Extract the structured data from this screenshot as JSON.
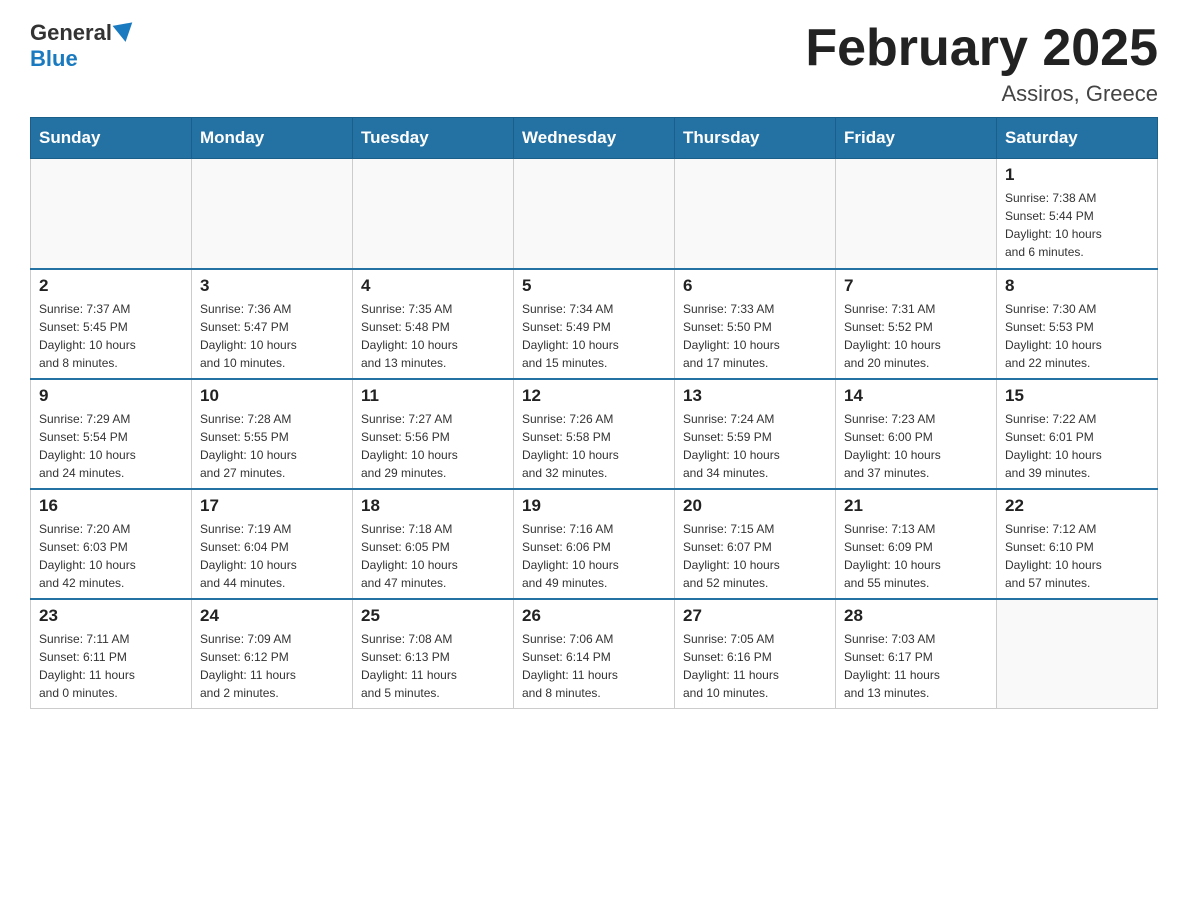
{
  "header": {
    "logo_general": "General",
    "logo_blue": "Blue",
    "month_title": "February 2025",
    "location": "Assiros, Greece"
  },
  "days_of_week": [
    "Sunday",
    "Monday",
    "Tuesday",
    "Wednesday",
    "Thursday",
    "Friday",
    "Saturday"
  ],
  "weeks": [
    [
      {
        "day": "",
        "info": ""
      },
      {
        "day": "",
        "info": ""
      },
      {
        "day": "",
        "info": ""
      },
      {
        "day": "",
        "info": ""
      },
      {
        "day": "",
        "info": ""
      },
      {
        "day": "",
        "info": ""
      },
      {
        "day": "1",
        "info": "Sunrise: 7:38 AM\nSunset: 5:44 PM\nDaylight: 10 hours\nand 6 minutes."
      }
    ],
    [
      {
        "day": "2",
        "info": "Sunrise: 7:37 AM\nSunset: 5:45 PM\nDaylight: 10 hours\nand 8 minutes."
      },
      {
        "day": "3",
        "info": "Sunrise: 7:36 AM\nSunset: 5:47 PM\nDaylight: 10 hours\nand 10 minutes."
      },
      {
        "day": "4",
        "info": "Sunrise: 7:35 AM\nSunset: 5:48 PM\nDaylight: 10 hours\nand 13 minutes."
      },
      {
        "day": "5",
        "info": "Sunrise: 7:34 AM\nSunset: 5:49 PM\nDaylight: 10 hours\nand 15 minutes."
      },
      {
        "day": "6",
        "info": "Sunrise: 7:33 AM\nSunset: 5:50 PM\nDaylight: 10 hours\nand 17 minutes."
      },
      {
        "day": "7",
        "info": "Sunrise: 7:31 AM\nSunset: 5:52 PM\nDaylight: 10 hours\nand 20 minutes."
      },
      {
        "day": "8",
        "info": "Sunrise: 7:30 AM\nSunset: 5:53 PM\nDaylight: 10 hours\nand 22 minutes."
      }
    ],
    [
      {
        "day": "9",
        "info": "Sunrise: 7:29 AM\nSunset: 5:54 PM\nDaylight: 10 hours\nand 24 minutes."
      },
      {
        "day": "10",
        "info": "Sunrise: 7:28 AM\nSunset: 5:55 PM\nDaylight: 10 hours\nand 27 minutes."
      },
      {
        "day": "11",
        "info": "Sunrise: 7:27 AM\nSunset: 5:56 PM\nDaylight: 10 hours\nand 29 minutes."
      },
      {
        "day": "12",
        "info": "Sunrise: 7:26 AM\nSunset: 5:58 PM\nDaylight: 10 hours\nand 32 minutes."
      },
      {
        "day": "13",
        "info": "Sunrise: 7:24 AM\nSunset: 5:59 PM\nDaylight: 10 hours\nand 34 minutes."
      },
      {
        "day": "14",
        "info": "Sunrise: 7:23 AM\nSunset: 6:00 PM\nDaylight: 10 hours\nand 37 minutes."
      },
      {
        "day": "15",
        "info": "Sunrise: 7:22 AM\nSunset: 6:01 PM\nDaylight: 10 hours\nand 39 minutes."
      }
    ],
    [
      {
        "day": "16",
        "info": "Sunrise: 7:20 AM\nSunset: 6:03 PM\nDaylight: 10 hours\nand 42 minutes."
      },
      {
        "day": "17",
        "info": "Sunrise: 7:19 AM\nSunset: 6:04 PM\nDaylight: 10 hours\nand 44 minutes."
      },
      {
        "day": "18",
        "info": "Sunrise: 7:18 AM\nSunset: 6:05 PM\nDaylight: 10 hours\nand 47 minutes."
      },
      {
        "day": "19",
        "info": "Sunrise: 7:16 AM\nSunset: 6:06 PM\nDaylight: 10 hours\nand 49 minutes."
      },
      {
        "day": "20",
        "info": "Sunrise: 7:15 AM\nSunset: 6:07 PM\nDaylight: 10 hours\nand 52 minutes."
      },
      {
        "day": "21",
        "info": "Sunrise: 7:13 AM\nSunset: 6:09 PM\nDaylight: 10 hours\nand 55 minutes."
      },
      {
        "day": "22",
        "info": "Sunrise: 7:12 AM\nSunset: 6:10 PM\nDaylight: 10 hours\nand 57 minutes."
      }
    ],
    [
      {
        "day": "23",
        "info": "Sunrise: 7:11 AM\nSunset: 6:11 PM\nDaylight: 11 hours\nand 0 minutes."
      },
      {
        "day": "24",
        "info": "Sunrise: 7:09 AM\nSunset: 6:12 PM\nDaylight: 11 hours\nand 2 minutes."
      },
      {
        "day": "25",
        "info": "Sunrise: 7:08 AM\nSunset: 6:13 PM\nDaylight: 11 hours\nand 5 minutes."
      },
      {
        "day": "26",
        "info": "Sunrise: 7:06 AM\nSunset: 6:14 PM\nDaylight: 11 hours\nand 8 minutes."
      },
      {
        "day": "27",
        "info": "Sunrise: 7:05 AM\nSunset: 6:16 PM\nDaylight: 11 hours\nand 10 minutes."
      },
      {
        "day": "28",
        "info": "Sunrise: 7:03 AM\nSunset: 6:17 PM\nDaylight: 11 hours\nand 13 minutes."
      },
      {
        "day": "",
        "info": ""
      }
    ]
  ]
}
